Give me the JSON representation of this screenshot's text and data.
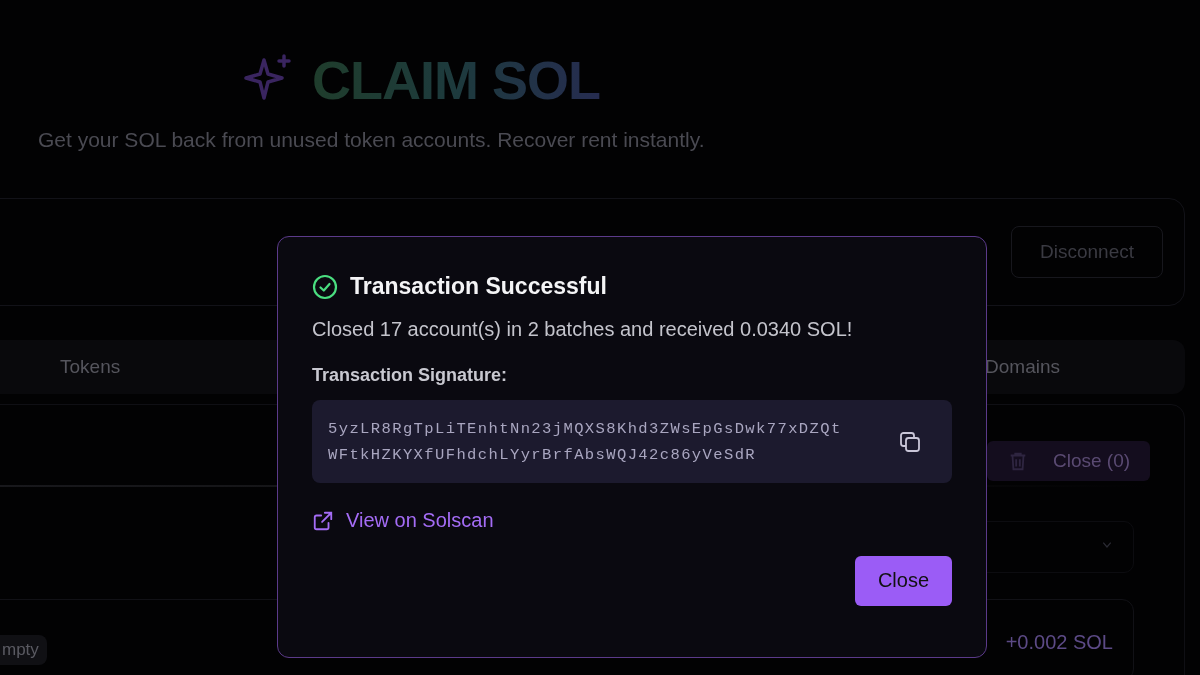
{
  "header": {
    "title": "CLAIM SOL",
    "subtitle": "Get your SOL back from unused token accounts. Recover rent instantly."
  },
  "wallet": {
    "disconnect_button": "Disconnect"
  },
  "tabs": [
    {
      "label": "Tokens",
      "selected": false
    },
    {
      "label": "Domains",
      "selected": false
    }
  ],
  "panel": {
    "close_button": "Close (0)",
    "token_row": {
      "badge": "mpty",
      "amount": "+0.002 SOL"
    }
  },
  "dialog": {
    "title": "Transaction Successful",
    "message": "Closed 17 account(s) in 2 batches and received 0.0340 SOL!",
    "signature_label": "Transaction Signature:",
    "signature": "5yzLR8RgTpLiTEnhtNn23jMQXS8Khd3ZWsEpGsDwk77xDZQtWFtkHZKYXfUFhdchLYyrBrfAbsWQJ42c86yVeSdR",
    "link": "View on Solscan",
    "close_button": "Close"
  }
}
